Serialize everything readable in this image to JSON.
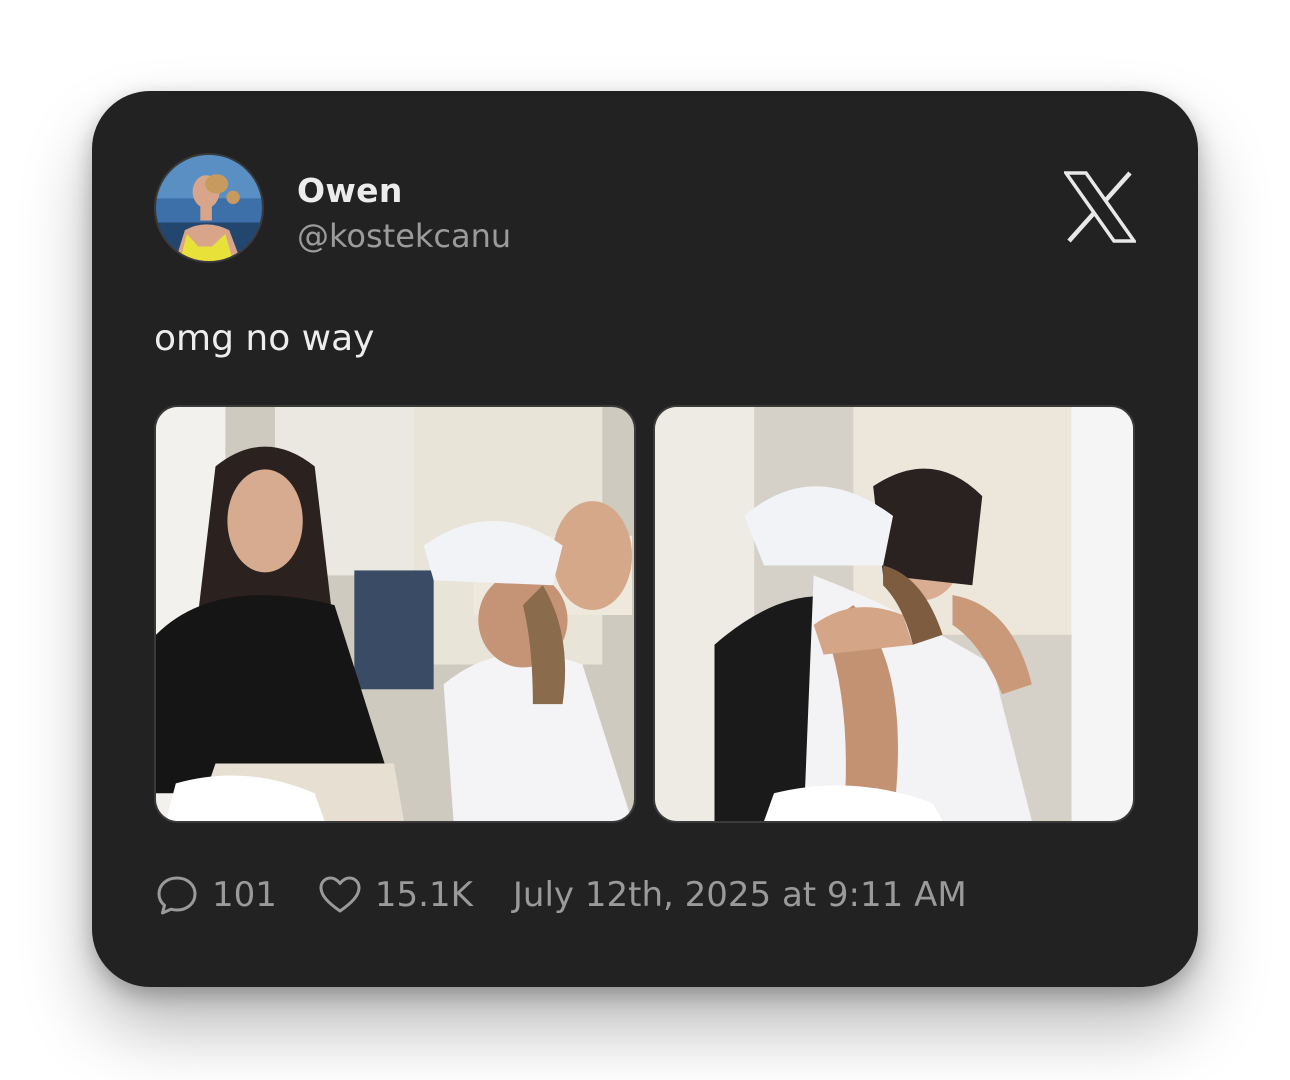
{
  "tweet": {
    "author_name": "Owen",
    "author_handle": "@kostekcanu",
    "text": "omg no way",
    "avatar_icon": "profile-photo",
    "platform_icon": "x-logo-icon",
    "media": [
      {
        "description_icon": "photo-1"
      },
      {
        "description_icon": "photo-2"
      }
    ],
    "stats": {
      "replies": "101",
      "likes": "15.1K"
    },
    "timestamp": "July 12th, 2025 at 9:11 AM"
  },
  "colors": {
    "card_background": "#222222",
    "name": "#ececec",
    "secondary_text": "#9a9a9a",
    "page_background": "#ffffff"
  }
}
